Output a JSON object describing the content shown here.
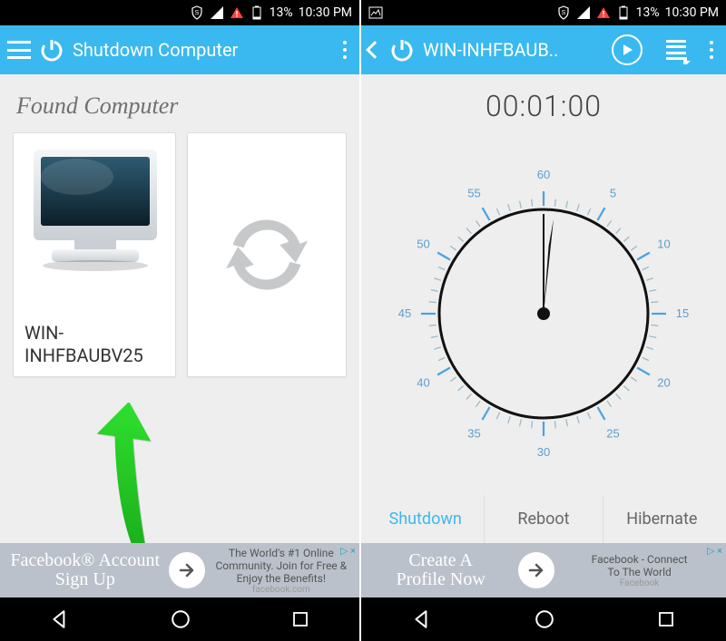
{
  "status": {
    "battery": "13%",
    "time": "10:30 PM"
  },
  "left": {
    "title": "Shutdown Computer",
    "section": "Found Computer",
    "pcname": "WIN-INHFBAUBV25",
    "ad": {
      "big1": "Facebook® Account",
      "big2": "Sign Up",
      "small1": "The World's #1 Online",
      "small2": "Community. Join for Free &",
      "small3": "Enjoy the Benefits!",
      "sub": "facebook.com"
    }
  },
  "right": {
    "title": "WIN-INHFBAUB..",
    "timer": "00:01:00",
    "actions": {
      "shutdown": "Shutdown",
      "reboot": "Reboot",
      "hibernate": "Hibernate"
    },
    "ad": {
      "big1": "Create A",
      "big2": "Profile Now",
      "small1": "Facebook - Connect",
      "small2": "To The World",
      "sub": "Facebook"
    }
  },
  "dial": {
    "labels": {
      "60": "60",
      "5": "5",
      "10": "10",
      "15": "15",
      "20": "20",
      "25": "25",
      "30": "30",
      "35": "35",
      "40": "40",
      "45": "45",
      "50": "50",
      "55": "55"
    }
  }
}
